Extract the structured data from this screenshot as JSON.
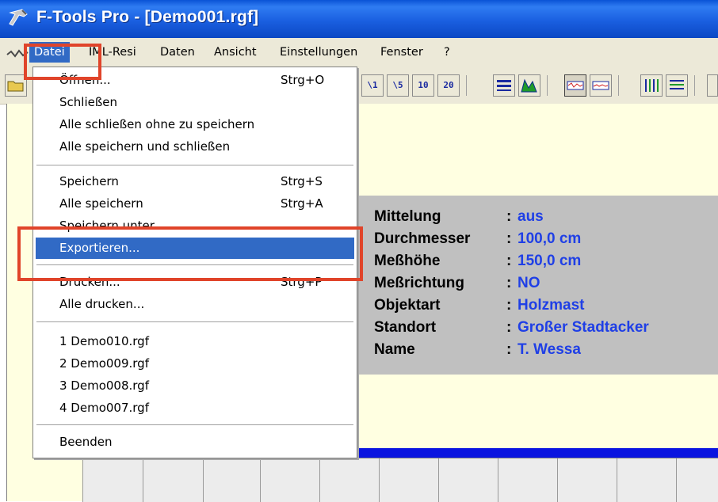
{
  "window": {
    "title": "F-Tools Pro - [Demo001.rgf]"
  },
  "menubar": {
    "items": [
      {
        "label": "Datei"
      },
      {
        "label": "IML-Resi"
      },
      {
        "label": "Daten"
      },
      {
        "label": "Ansicht"
      },
      {
        "label": "Einstellungen"
      },
      {
        "label": "Fenster"
      },
      {
        "label": "?"
      }
    ]
  },
  "toolbar": {
    "buttons": [
      "folder-icon",
      "x1-icon",
      "x5-icon",
      "x10-icon",
      "x20-icon",
      "compare-icon",
      "chart-icon",
      "wave-view-icon",
      "wave-view2-icon",
      "bars-icon",
      "list-icon"
    ],
    "labels": {
      "x1": "\\1",
      "x5": "\\5",
      "x10": "10",
      "x20": "20"
    }
  },
  "dropdown": {
    "items": [
      {
        "label": "Öffnen...",
        "shortcut": "Strg+O"
      },
      {
        "label": "Schließen",
        "shortcut": ""
      },
      {
        "label": "Alle schließen ohne zu speichern",
        "shortcut": ""
      },
      {
        "label": "Alle speichern und schließen",
        "shortcut": ""
      },
      {
        "label": "Speichern",
        "shortcut": "Strg+S"
      },
      {
        "label": "Alle speichern",
        "shortcut": "Strg+A"
      },
      {
        "label": "Speichern unter...",
        "shortcut": ""
      },
      {
        "label": "Exportieren...",
        "shortcut": ""
      },
      {
        "label": "Drucken...",
        "shortcut": "Strg+P"
      },
      {
        "label": "Alle drucken...",
        "shortcut": ""
      },
      {
        "label": "1 Demo010.rgf",
        "shortcut": ""
      },
      {
        "label": "2 Demo009.rgf",
        "shortcut": ""
      },
      {
        "label": "3 Demo008.rgf",
        "shortcut": ""
      },
      {
        "label": "4 Demo007.rgf",
        "shortcut": ""
      },
      {
        "label": "Beenden",
        "shortcut": ""
      }
    ],
    "highlighted": "Exportieren..."
  },
  "info_panel": {
    "rows": [
      {
        "label": "Mittelung",
        "value": "aus"
      },
      {
        "label": "Durchmesser",
        "value": "100,0 cm"
      },
      {
        "label": "Meßhöhe",
        "value": "150,0 cm"
      },
      {
        "label": "Meßrichtung",
        "value": "NO"
      },
      {
        "label": "Objektart",
        "value": "Holzmast"
      },
      {
        "label": "Standort",
        "value": "Großer Stadtacker"
      },
      {
        "label": "Name",
        "value": "T. Wessa"
      }
    ],
    "colon": ":"
  },
  "colors": {
    "titlebar": "#1a5fe0",
    "menu_highlight": "#316ac5",
    "info_value": "#1f3fe6",
    "annotation": "#e0442a",
    "client_bg": "#ffffe1",
    "panel_bg": "#c0c0c0"
  }
}
